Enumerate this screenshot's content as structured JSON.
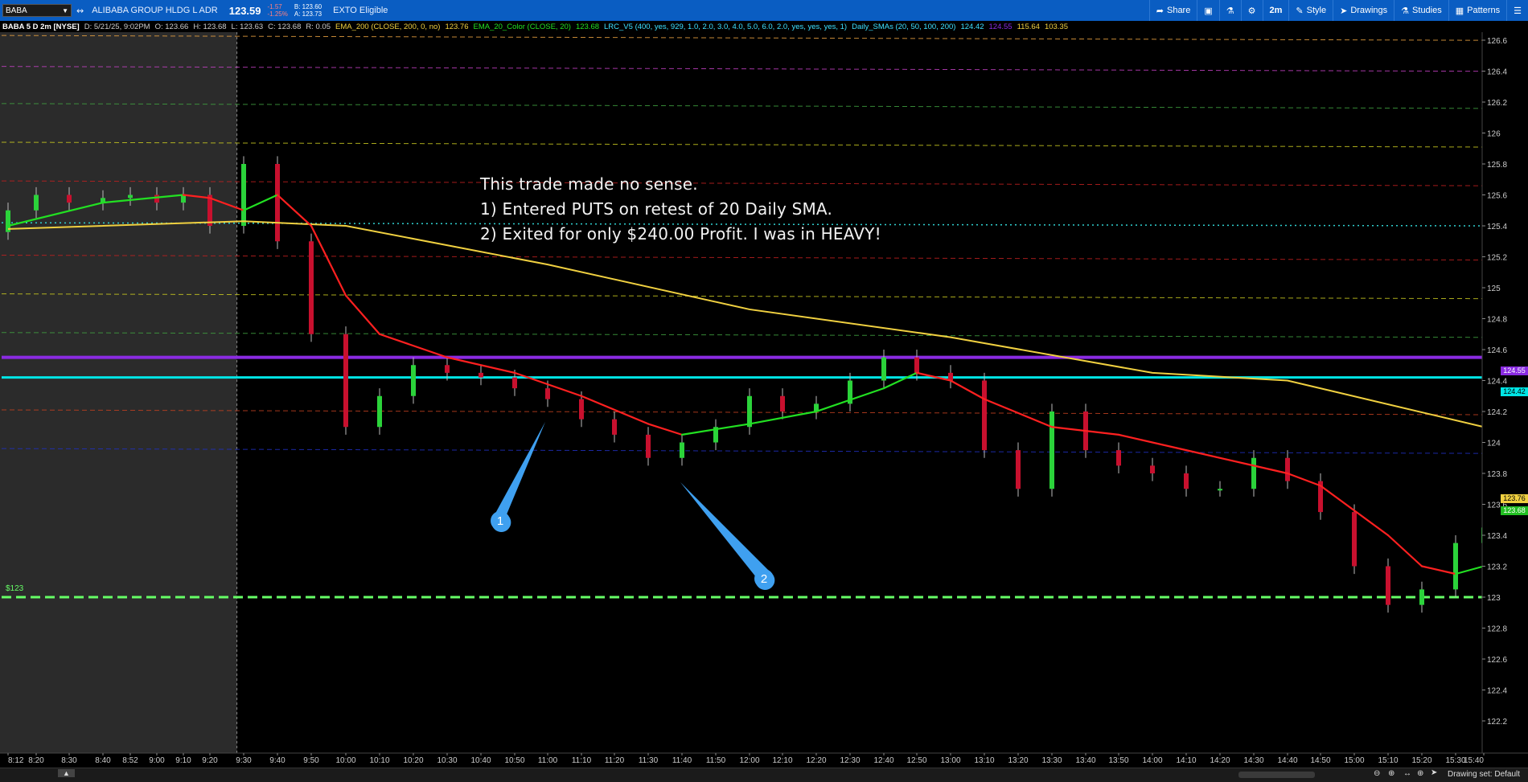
{
  "toolbar": {
    "symbol": "BABA",
    "company": "ALIBABA GROUP HLDG L ADR",
    "last_price": "123.59",
    "change": "-1.57",
    "change_pct": "-1.25%",
    "bid": "B: 123.60",
    "ask": "A: 123.73",
    "eligibility": "EXTO Eligible",
    "share_label": "Share",
    "timeframe_label": "2m",
    "style_label": "Style",
    "drawings_label": "Drawings",
    "studies_label": "Studies",
    "patterns_label": "Patterns"
  },
  "infobar": {
    "chart_title": "BABA 5 D 2m [NYSE]",
    "date": "D: 5/21/25, 9:02PM",
    "open": "O: 123.66",
    "high": "H: 123.68",
    "low": "L: 123.63",
    "close": "C: 123.68",
    "range": "R: 0.05",
    "ema200_label": "EMA_200 (CLOSE, 200, 0, no)",
    "ema200_value": "123.76",
    "ema20_label": "EMA_20_Color (CLOSE, 20)",
    "ema20_value": "123.68",
    "lrc_label": "LRC_V5 (400, yes, 929, 1.0, 2.0, 3.0, 4.0, 5.0, 6.0, 2.0, yes, yes, yes, 1)",
    "sma_label": "Daily_SMAs (20, 50, 100, 200)",
    "sma20_value": "124.42",
    "sma50_value": "124.55",
    "sma100_value": "115.64",
    "sma200_value": "103.35"
  },
  "annotation": {
    "line1": "This trade made no sense.",
    "line2": "1) Entered PUTS on retest of 20 Daily SMA.",
    "line3": "2) Exited for only $240.00 Profit. I was in HEAVY!"
  },
  "callouts": [
    "1",
    "2"
  ],
  "level_label": "$123",
  "price_tags": {
    "sma50": "124.55",
    "sma20": "124.42",
    "ema200": "123.76",
    "ema20": "123.68"
  },
  "statusbar": {
    "drawing_set": "Drawing set: Default"
  },
  "colors": {
    "up": "#2bd33a",
    "down": "#c8102e",
    "ema20_up": "#22e022",
    "ema20_down": "#ff2020",
    "ema200": "#f0d040",
    "sma50": "#8a2be2",
    "sma20": "#00e5e5",
    "level123": "#66ff66"
  },
  "chart_data": {
    "type": "line",
    "title": "BABA 5 D 2m [NYSE]",
    "xlabel": "",
    "ylabel": "",
    "x_ticks": [
      "8:12",
      "8:20",
      "8:30",
      "8:40",
      "8:52",
      "9:00",
      "9:10",
      "9:20",
      "9:30",
      "9:40",
      "9:50",
      "10:00",
      "10:10",
      "10:20",
      "10:30",
      "10:40",
      "10:50",
      "11:00",
      "11:10",
      "11:20",
      "11:30",
      "11:40",
      "11:50",
      "12:00",
      "12:10",
      "12:20",
      "12:30",
      "12:40",
      "12:50",
      "13:00",
      "13:10",
      "13:20",
      "13:30",
      "13:40",
      "13:50",
      "14:00",
      "14:10",
      "14:20",
      "14:30",
      "14:40",
      "14:50",
      "15:00",
      "15:10",
      "15:20",
      "15:30",
      "15:40"
    ],
    "y_ticks": [
      126.6,
      126.4,
      126.2,
      126,
      125.8,
      125.6,
      125.4,
      125.2,
      125,
      124.8,
      124.6,
      124.4,
      124.2,
      124,
      123.8,
      123.6,
      123.4,
      123.2,
      123,
      122.8,
      122.6,
      122.4,
      122.2
    ],
    "ylim": [
      122.2,
      126.6
    ],
    "premarket_end": "9:28",
    "series": [
      {
        "name": "EMA_200",
        "x": [
          "8:12",
          "9:30",
          "10:00",
          "11:00",
          "12:00",
          "13:00",
          "14:00",
          "14:40",
          "15:40"
        ],
        "values": [
          125.38,
          125.43,
          125.4,
          125.15,
          124.86,
          124.68,
          124.45,
          124.4,
          124.1
        ]
      },
      {
        "name": "EMA_20_Color",
        "x": [
          "8:12",
          "8:40",
          "9:10",
          "9:20",
          "9:30",
          "9:40",
          "9:50",
          "10:00",
          "10:10",
          "10:30",
          "10:50",
          "11:10",
          "11:30",
          "11:40",
          "12:00",
          "12:20",
          "12:40",
          "12:50",
          "13:00",
          "13:10",
          "13:30",
          "13:50",
          "14:10",
          "14:30",
          "14:40",
          "14:50",
          "15:10",
          "15:20",
          "15:30",
          "15:40"
        ],
        "values": [
          125.4,
          125.55,
          125.6,
          125.58,
          125.5,
          125.6,
          125.4,
          124.95,
          124.7,
          124.55,
          124.45,
          124.3,
          124.12,
          124.05,
          124.12,
          124.2,
          124.35,
          124.45,
          124.4,
          124.28,
          124.1,
          124.05,
          123.95,
          123.85,
          123.8,
          123.72,
          123.4,
          123.2,
          123.15,
          123.2
        ]
      }
    ],
    "horizontal_levels": [
      {
        "name": "Daily SMA 50",
        "value": 124.55
      },
      {
        "name": "Daily SMA 20",
        "value": 124.42
      },
      {
        "name": "$123",
        "value": 123.0
      }
    ],
    "candles": {
      "x": [
        "8:12",
        "8:20",
        "8:30",
        "8:40",
        "8:52",
        "9:00",
        "9:10",
        "9:20",
        "9:30",
        "9:40",
        "9:50",
        "10:00",
        "10:10",
        "10:20",
        "10:30",
        "10:40",
        "10:50",
        "11:00",
        "11:10",
        "11:20",
        "11:30",
        "11:40",
        "11:50",
        "12:00",
        "12:10",
        "12:20",
        "12:30",
        "12:40",
        "12:50",
        "13:00",
        "13:10",
        "13:20",
        "13:30",
        "13:40",
        "13:50",
        "14:00",
        "14:10",
        "14:20",
        "14:30",
        "14:40",
        "14:50",
        "15:00",
        "15:10",
        "15:20",
        "15:30",
        "15:40"
      ],
      "open": [
        125.36,
        125.5,
        125.6,
        125.55,
        125.58,
        125.6,
        125.55,
        125.6,
        125.4,
        125.8,
        125.3,
        124.7,
        124.1,
        124.3,
        124.5,
        124.45,
        124.42,
        124.35,
        124.28,
        124.15,
        124.05,
        123.9,
        124.0,
        124.1,
        124.3,
        124.2,
        124.25,
        124.4,
        124.55,
        124.45,
        124.4,
        123.95,
        123.7,
        124.2,
        123.95,
        123.85,
        123.8,
        123.7,
        123.7,
        123.9,
        123.75,
        123.55,
        123.2,
        122.95,
        123.05,
        123.35
      ],
      "close": [
        125.5,
        125.6,
        125.55,
        125.58,
        125.6,
        125.55,
        125.6,
        125.4,
        125.8,
        125.3,
        124.7,
        124.1,
        124.3,
        124.5,
        124.45,
        124.42,
        124.35,
        124.28,
        124.15,
        124.05,
        123.9,
        124.0,
        124.1,
        124.3,
        124.2,
        124.25,
        124.4,
        124.55,
        124.45,
        124.4,
        123.95,
        123.7,
        124.2,
        123.95,
        123.85,
        123.8,
        123.7,
        123.7,
        123.9,
        123.75,
        123.55,
        123.2,
        122.95,
        123.05,
        123.35,
        123.45
      ]
    }
  }
}
